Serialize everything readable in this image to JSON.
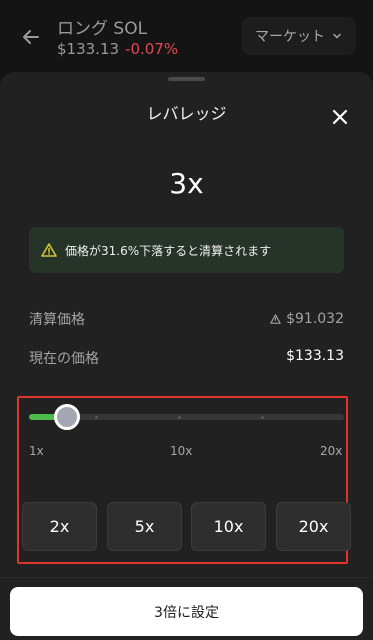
{
  "header": {
    "title": "ロング SOL",
    "price": "$133.13",
    "change": "-0.07%",
    "market_label": "マーケット"
  },
  "sheet": {
    "title": "レバレッジ",
    "leverage_value": "3x",
    "warning": "価格が31.6%下落すると清算されます",
    "liquidation_label": "清算価格",
    "liquidation_value": "$91.032",
    "current_label": "現在の価格",
    "current_value": "$133.13",
    "slider": {
      "min_label": "1x",
      "mid_label": "10x",
      "max_label": "20x",
      "value_fraction": 0.105
    },
    "presets": [
      "2x",
      "5x",
      "10x",
      "20x"
    ],
    "confirm_label": "3倍に設定"
  },
  "colors": {
    "accent_green": "#4cbb4a",
    "negative_red": "#e0484f",
    "highlight_red": "#e0352b",
    "warning_yellow": "#d6c23a"
  },
  "icons": [
    "arrow-left-icon",
    "chevron-down-icon",
    "close-icon",
    "warning-icon",
    "warning-small-icon"
  ]
}
